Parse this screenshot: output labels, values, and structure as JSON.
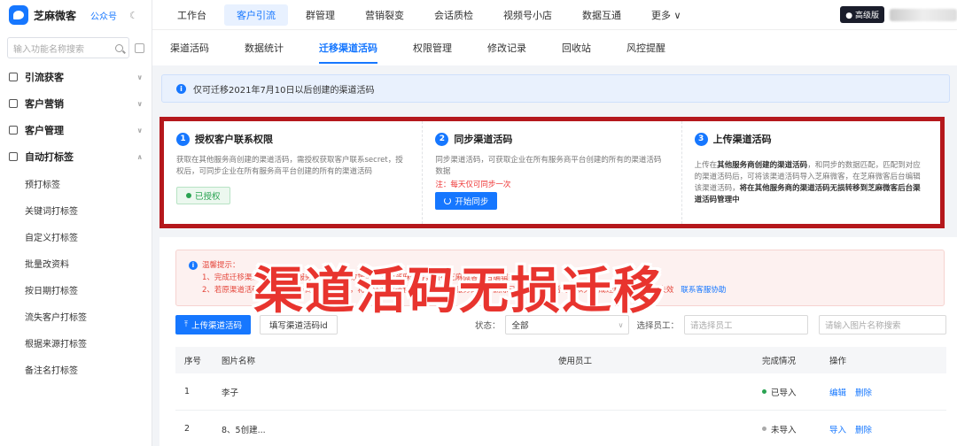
{
  "brand": {
    "name": "芝麻微客",
    "sub": "公众号"
  },
  "search": {
    "placeholder": "输入功能名称搜索"
  },
  "sidebar": {
    "groups": [
      {
        "label": "引流获客"
      },
      {
        "label": "客户营销"
      },
      {
        "label": "客户管理"
      },
      {
        "label": "自动打标签"
      }
    ],
    "items": [
      {
        "label": "预打标签"
      },
      {
        "label": "关键词打标签"
      },
      {
        "label": "自定义打标签"
      },
      {
        "label": "批量改资料"
      },
      {
        "label": "按日期打标签"
      },
      {
        "label": "流失客户打标签"
      },
      {
        "label": "根据来源打标签"
      },
      {
        "label": "备注名打标签"
      }
    ]
  },
  "topnav": {
    "items": [
      {
        "label": "工作台"
      },
      {
        "label": "客户引流"
      },
      {
        "label": "群管理"
      },
      {
        "label": "营销裂变"
      },
      {
        "label": "会话质检"
      },
      {
        "label": "视频号小店"
      },
      {
        "label": "数据互通"
      },
      {
        "label": "更多 ∨"
      }
    ],
    "version_badge": "高级版"
  },
  "subtabs": [
    {
      "label": "渠道活码"
    },
    {
      "label": "数据统计"
    },
    {
      "label": "迁移渠道活码"
    },
    {
      "label": "权限管理"
    },
    {
      "label": "修改记录"
    },
    {
      "label": "回收站"
    },
    {
      "label": "风控提醒"
    }
  ],
  "info": "仅可迁移2021年7月10日以后创建的渠道活码",
  "steps": [
    {
      "num": "1",
      "title": "授权客户联系权限",
      "desc": "获取在其他服务商创建的渠道活码，需授权获取客户联系secret，授权后，可同步企业在所有服务商平台创建的所有的渠道活码",
      "button": "已授权"
    },
    {
      "num": "2",
      "title": "同步渠道活码",
      "desc": "同步渠道活码，可获取企业在所有服务商平台创建的所有的渠道活码数据",
      "note": "注：每天仅可同步一次",
      "button": "开始同步"
    },
    {
      "num": "3",
      "title": "上传渠道活码",
      "desc_a": "上传在",
      "desc_b": "其他服务商创建的渠道活码",
      "desc_c": "，和同步的数据匹配，匹配到对应的渠道活码后，可将该渠道活码导入芝麻微客，在芝麻微客后台编辑该渠道活码，",
      "desc_d": "将在其他服务商的渠道活码无损转移到芝麻微客后台渠道活码管理中"
    }
  ],
  "warning": {
    "title": "温馨提示：",
    "line1": "1、完成迁移渠道活码后，原服务商渠道活码数据将同步至芝麻微客，请在芝麻微客后台编辑渠道活码",
    "line2": "2、若原渠道活码已在其他服务商删除或失效，将无法完成迁移，请勿在其他服务商后台删除已迁移的渠道活码，以免造成迁移的渠道活码失效",
    "link": "联系客服协助"
  },
  "overlay": "渠道活码无损迁移",
  "toolbar": {
    "upload": "上传渠道活码",
    "fill": "填写渠道活码id",
    "status_label": "状态：",
    "status_value": "全部",
    "staff_label": "选择员工：",
    "staff_placeholder": "请选择员工",
    "name_placeholder": "请输入图片名称搜索"
  },
  "table": {
    "headers": [
      "序号",
      "图片名称",
      "使用员工",
      "完成情况",
      "操作"
    ],
    "rows": [
      {
        "index": "1",
        "name": "李子",
        "staff": "",
        "status": "已导入",
        "status_color": "#2aa352",
        "actions": [
          "编辑",
          "删除"
        ]
      },
      {
        "index": "2",
        "name": "8、5创建...",
        "staff": "",
        "status": "未导入",
        "status_color": "#aaaaaa",
        "actions": [
          "导入",
          "删除"
        ]
      }
    ]
  }
}
